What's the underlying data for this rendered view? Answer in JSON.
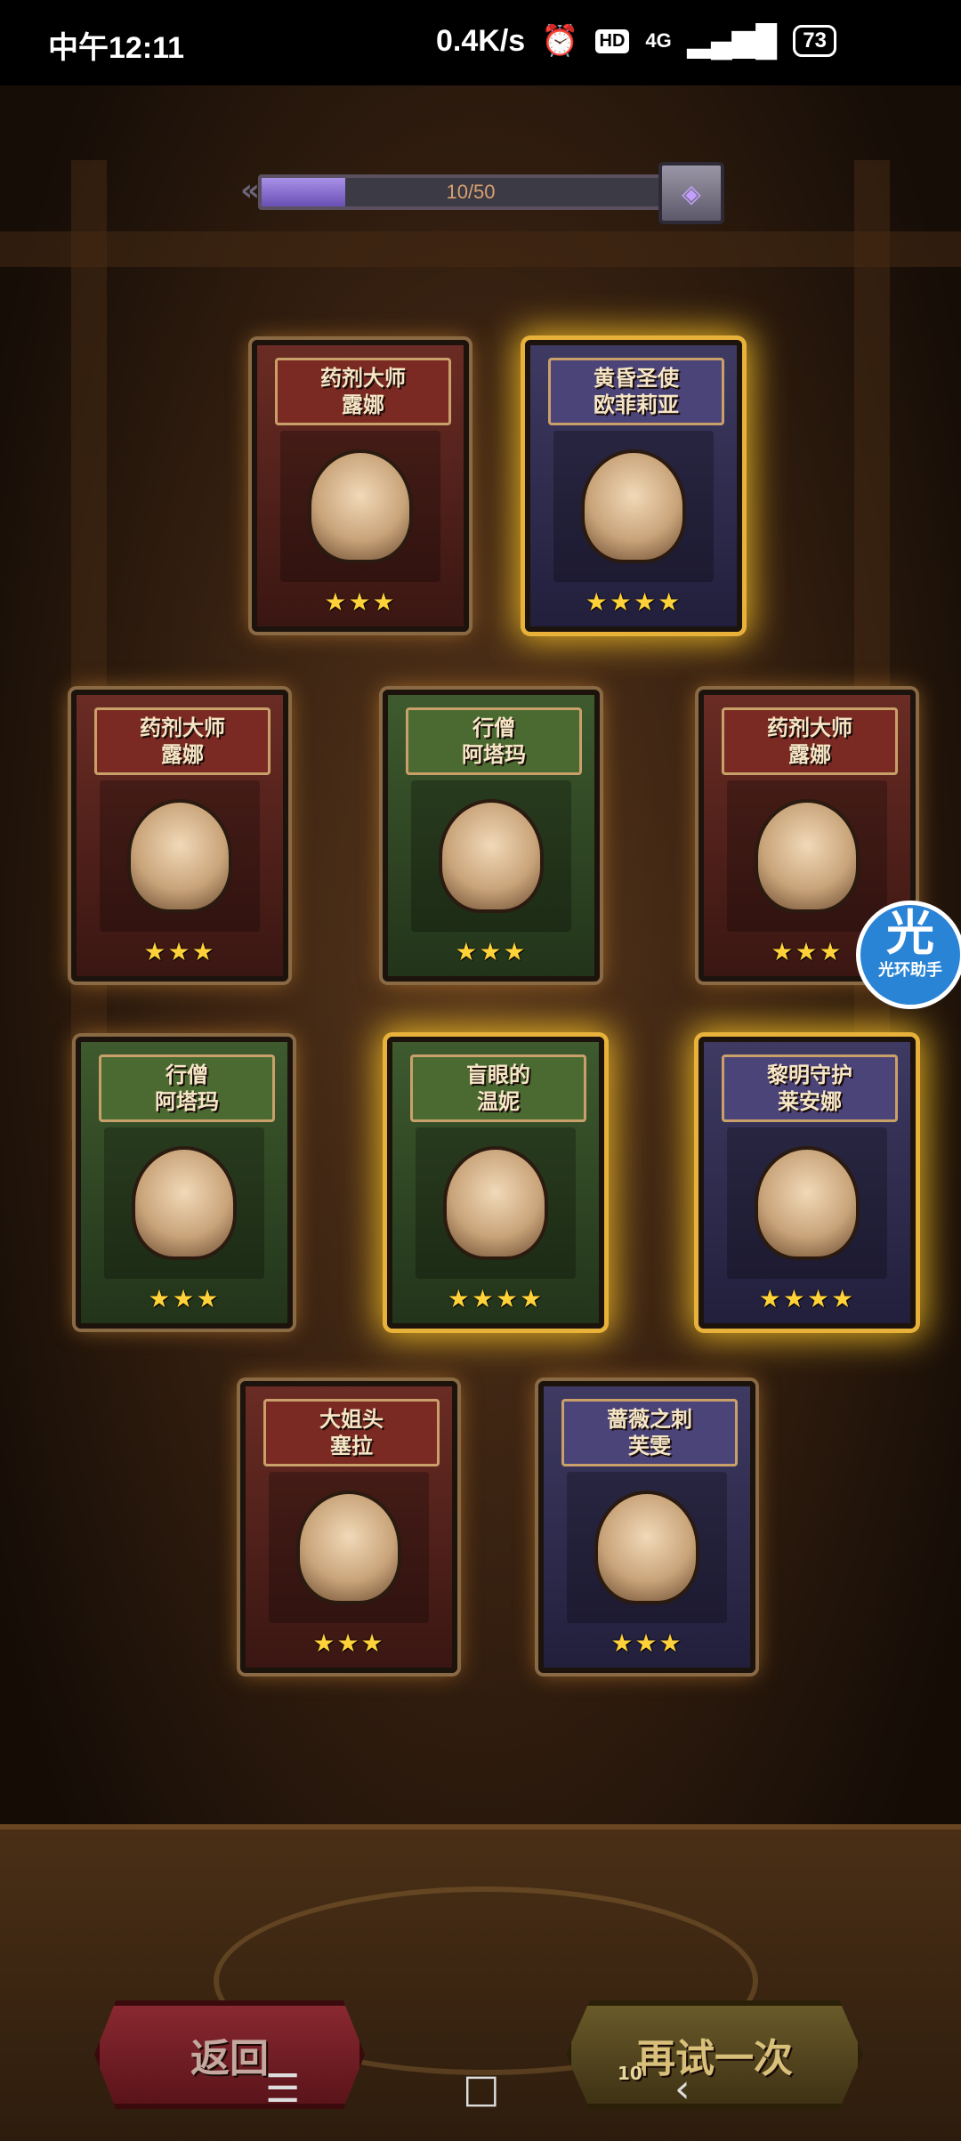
{
  "status_bar": {
    "time": "中午12:11",
    "network_speed": "0.4K/s",
    "hd": "HD",
    "network": "4G",
    "battery": "73"
  },
  "progress": {
    "label": "10/50",
    "fraction": 0.2
  },
  "cards": [
    {
      "title_line1": "药剂大师",
      "title_line2": "露娜",
      "stars": "★★★",
      "frame": "red",
      "glow": "normal"
    },
    {
      "title_line1": "黄昏圣使",
      "title_line2": "欧菲莉亚",
      "stars": "★★★★",
      "frame": "purple",
      "glow": "gold"
    },
    {
      "title_line1": "药剂大师",
      "title_line2": "露娜",
      "stars": "★★★",
      "frame": "red",
      "glow": "normal"
    },
    {
      "title_line1": "行僧",
      "title_line2": "阿塔玛",
      "stars": "★★★",
      "frame": "green",
      "glow": "normal"
    },
    {
      "title_line1": "药剂大师",
      "title_line2": "露娜",
      "stars": "★★★",
      "frame": "red",
      "glow": "normal"
    },
    {
      "title_line1": "行僧",
      "title_line2": "阿塔玛",
      "stars": "★★★",
      "frame": "green",
      "glow": "normal"
    },
    {
      "title_line1": "盲眼的",
      "title_line2": "温妮",
      "stars": "★★★★",
      "frame": "green",
      "glow": "gold"
    },
    {
      "title_line1": "黎明守护",
      "title_line2": "莱安娜",
      "stars": "★★★★",
      "frame": "purple",
      "glow": "gold"
    },
    {
      "title_line1": "大姐头",
      "title_line2": "塞拉",
      "stars": "★★★",
      "frame": "red",
      "glow": "normal"
    },
    {
      "title_line1": "蔷薇之刺",
      "title_line2": "芙雯",
      "stars": "★★★",
      "frame": "purple",
      "glow": "normal"
    }
  ],
  "assistant": {
    "icon_text": "光",
    "label": "光环助手"
  },
  "buttons": {
    "back": "返回",
    "retry": "再试一次",
    "retry_cost": "10"
  },
  "nav": {
    "menu": "☰",
    "home": "□",
    "back": "‹"
  },
  "colors": {
    "gold_glow": "#e8b23a",
    "progress_fill": "#8a70d0"
  }
}
